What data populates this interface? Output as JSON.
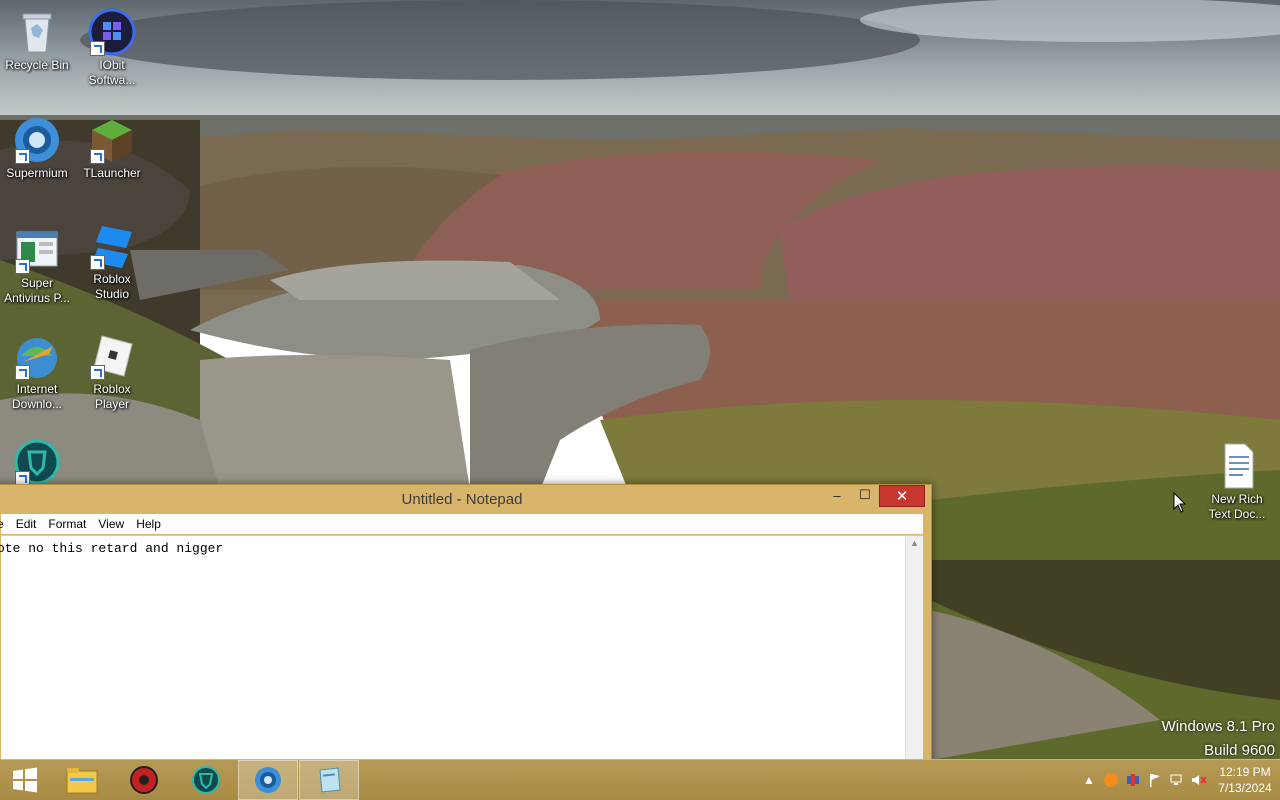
{
  "desktop": {
    "icons": [
      {
        "label": "Recycle Bin"
      },
      {
        "label": "IObit Softwa..."
      },
      {
        "label": "Supermium"
      },
      {
        "label": "TLauncher"
      },
      {
        "label": "Super Antivirus P..."
      },
      {
        "label": "Roblox Studio"
      },
      {
        "label": "Internet Downlo..."
      },
      {
        "label": "Roblox Player"
      },
      {
        "label": ""
      },
      {
        "label": "New Rich Text Doc..."
      }
    ]
  },
  "notepad": {
    "title": "Untitled - Notepad",
    "menu": [
      "e",
      "Edit",
      "Format",
      "View",
      "Help"
    ],
    "content": "ote no this retard and nigger",
    "controls": {
      "minimize": "–",
      "maximize": "☐",
      "close": "✕"
    }
  },
  "watermark": {
    "line1": "Windows 8.1 Pro",
    "line2": "Build 9600"
  },
  "taskbar": {
    "items": [
      {
        "name": "start-button"
      },
      {
        "name": "file-explorer"
      },
      {
        "name": "app-red"
      },
      {
        "name": "app-shield"
      },
      {
        "name": "supermium"
      },
      {
        "name": "notepad"
      }
    ],
    "clock": {
      "time": "12:19 PM",
      "date": "7/13/2024"
    },
    "tray_up": "▲"
  },
  "colors": {
    "taskbar": "#a98c47",
    "close": "#c7392f",
    "titlebar": "#d9b56c"
  }
}
